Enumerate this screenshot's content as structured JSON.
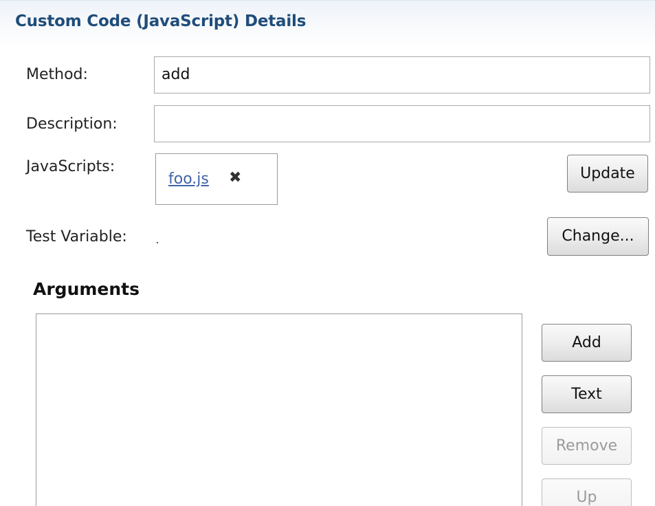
{
  "header": {
    "title": "Custom Code (JavaScript) Details"
  },
  "form": {
    "method_label": "Method:",
    "method_value": "add",
    "description_label": "Description:",
    "description_value": "",
    "javascripts_label": "JavaScripts:",
    "javascript_files": [
      "foo.js"
    ],
    "remove_glyph": "✖",
    "update_button": "Update",
    "test_variable_label": "Test Variable:",
    "test_variable_value": "",
    "change_button": "Change..."
  },
  "arguments": {
    "title": "Arguments",
    "items": [],
    "buttons": {
      "add": "Add",
      "text": "Text",
      "remove": "Remove",
      "up": "Up"
    }
  },
  "colors": {
    "header_text": "#1f4d7a",
    "link": "#3f63a6",
    "disabled_text": "#9a9a9a"
  },
  "icons": {
    "remove_file": "close-icon"
  }
}
